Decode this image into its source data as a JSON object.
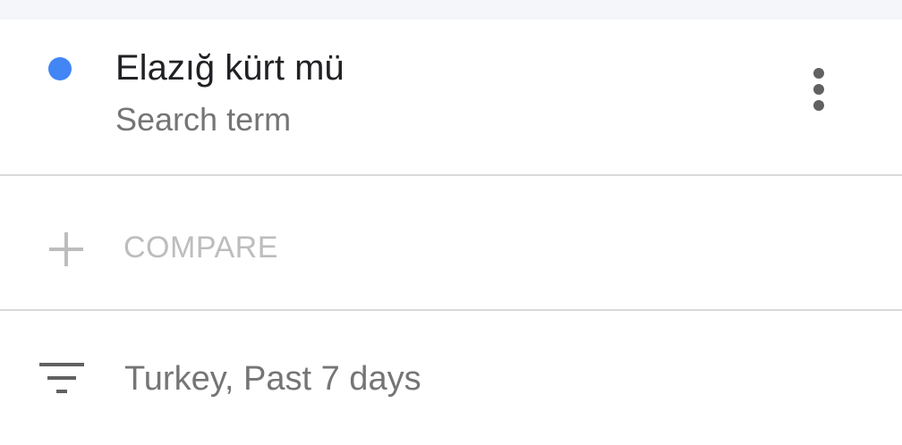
{
  "term": {
    "title": "Elazığ kürt mü",
    "subtitle": "Search term",
    "series_color": "#4285f4",
    "more_icon": "more-vert-icon"
  },
  "compare": {
    "label": "COMPARE",
    "icon": "plus-icon"
  },
  "filter": {
    "label": "Turkey, Past 7 days",
    "icon": "filter-icon"
  },
  "colors": {
    "accent": "#4285f4",
    "text_primary": "#202124",
    "text_secondary": "#757575",
    "text_disabled": "#bdbdbd",
    "divider": "#dadada"
  }
}
